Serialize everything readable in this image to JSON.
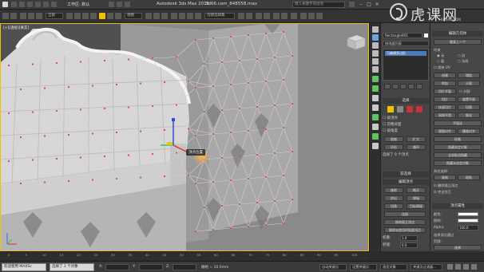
{
  "app": {
    "title": "Autodesk 3ds Max 2016",
    "file": "3d66.com_848558.max",
    "workspace": "工作区: 默认",
    "search_placeholder": "键入关键字或短语"
  },
  "toolbar": {
    "view_dropdown": "视图",
    "selection_dropdown": "创建选择集"
  },
  "viewport": {
    "label": "[+][透视][真实]",
    "tooltip": "顶点位置"
  },
  "command_panel": {
    "object_name": "Rectangle001",
    "modifier_list_label": "修改器列表",
    "stack_item": "可编辑多边形",
    "selection_header": "选择",
    "soft_selection_header": "软选择",
    "edit_vertices_header": "编辑顶点",
    "edit_geometry_header": "编辑几何体",
    "buttons": {
      "remove": "移除",
      "break": "断开",
      "extrude": "挤出",
      "weld": "焊接",
      "chamfer": "切角",
      "target_weld": "目标焊接",
      "connect": "连接",
      "remove_isolated": "移除孤立顶点",
      "remove_unused_map": "移除未使用的贴图顶点"
    },
    "weight_label": "权重:",
    "weight_value": "1.0",
    "crease_label": "折缝:",
    "crease_value": "0.0"
  },
  "properties_panel": {
    "edit_geometry_header": "编辑几何体",
    "repeat_last": "重复上一个",
    "constraints_label": "约束",
    "none_label": "无",
    "edge_label": "边",
    "face_label": "面",
    "normal_label": "法线",
    "preserve_uv": "保持 UV",
    "create": "创建",
    "collapse": "塌陷",
    "attach": "附加",
    "detach": "分离",
    "slice_plane": "切片平面",
    "split": "分割",
    "slice": "切片",
    "reset_plane": "重置平面",
    "quickslice": "快速切片",
    "cut": "切割",
    "msmooth": "网格平滑",
    "tessellate": "细化",
    "make_planar": "平面化",
    "view_align": "视图对齐",
    "grid_align": "栅格对齐",
    "relax": "松弛",
    "hide_selected": "隐藏选定对象",
    "unhide_all": "全部取消隐藏",
    "hide_unselected": "隐藏未选定对象",
    "named_selections": "命名选择:",
    "copy": "复制",
    "paste": "粘贴",
    "delete_isolated": "删除孤立顶点",
    "full_interactivity": "完全交互",
    "vertex_attributes_header": "顶点属性",
    "color_label": "颜色:",
    "illumination_label": "照明:",
    "alpha_label": "Alpha:",
    "alpha_value": "100.0",
    "select_by_vertex": "选择顶点通过",
    "range_label": "范围:",
    "select_button": "选择"
  },
  "timeline": {
    "ticks": [
      "0",
      "5",
      "10",
      "15",
      "20",
      "25",
      "30",
      "35",
      "40",
      "45",
      "50",
      "55",
      "60",
      "65",
      "70",
      "75",
      "80",
      "85",
      "90",
      "95",
      "100"
    ]
  },
  "statusbar": {
    "task1": "欢迎使用 MAXSc",
    "task2": "选择了 1 个对象",
    "x_label": "X:",
    "y_label": "Y:",
    "z_label": "Z:",
    "grid_label": "栅格 = 10.0mm",
    "auto_key": "自动关键点",
    "set_key": "设置关键点",
    "selected": "选定对象",
    "key_filters": "关键点过滤器..."
  },
  "watermark": {
    "brand": "虎课网",
    "sub": "HUKE88.COM"
  },
  "colors": {
    "viewport_bg": "#6f6f6f",
    "active_border": "#f2c200",
    "vertex": "#e04a5c",
    "panel": "#444444"
  }
}
